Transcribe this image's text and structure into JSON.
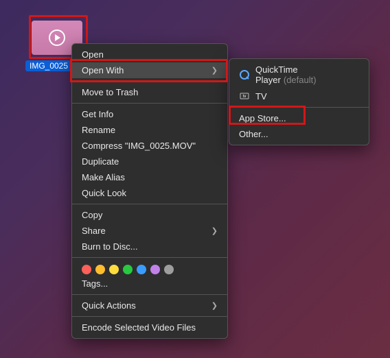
{
  "file": {
    "label": "IMG_0025"
  },
  "menu": {
    "open": "Open",
    "open_with": "Open With",
    "move_to_trash": "Move to Trash",
    "get_info": "Get Info",
    "rename": "Rename",
    "compress": "Compress \"IMG_0025.MOV\"",
    "duplicate": "Duplicate",
    "make_alias": "Make Alias",
    "quick_look": "Quick Look",
    "copy": "Copy",
    "share": "Share",
    "burn_to_disc": "Burn to Disc...",
    "tags": "Tags...",
    "quick_actions": "Quick Actions",
    "encode": "Encode Selected Video Files"
  },
  "submenu": {
    "quicktime": "QuickTime Player",
    "default": "(default)",
    "tv": "TV",
    "app_store": "App Store...",
    "other": "Other..."
  },
  "tag_colors": [
    "#ff6059",
    "#ffbd2e",
    "#fedc3d",
    "#28c840",
    "#3b9cff",
    "#c082e8",
    "#9e9e9e"
  ]
}
